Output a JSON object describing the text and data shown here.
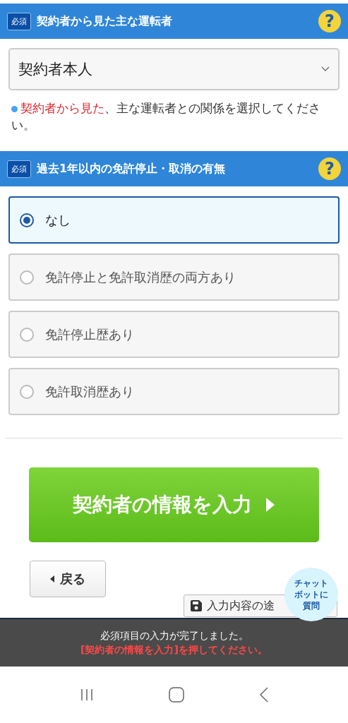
{
  "sections": [
    {
      "badge": "必須",
      "title": "契約者から見た主な運転者",
      "help": "?"
    },
    {
      "badge": "必須",
      "title": "過去1年以内の免許停止・取消の有無",
      "help": "?"
    }
  ],
  "select": {
    "value": "契約者本人"
  },
  "note": {
    "highlight": "契約者から見た",
    "text": "、主な運転者との関係を選択してください。"
  },
  "options": [
    {
      "label": "なし",
      "selected": true
    },
    {
      "label": "免許停止と免許取消歴の両方あり",
      "selected": false
    },
    {
      "label": "免許停止歴あり",
      "selected": false
    },
    {
      "label": "免許取消歴あり",
      "selected": false
    }
  ],
  "next_button": {
    "label": "契約者の情報を入力"
  },
  "back_button": {
    "label": "戻る"
  },
  "save_button": {
    "label": "入力内容の途"
  },
  "chatbot": {
    "label": "チャットボットに質問"
  },
  "toast": {
    "message": "必須項目の入力が完了しました。",
    "hint": "[契約者の情報を入力]を押してください。"
  }
}
